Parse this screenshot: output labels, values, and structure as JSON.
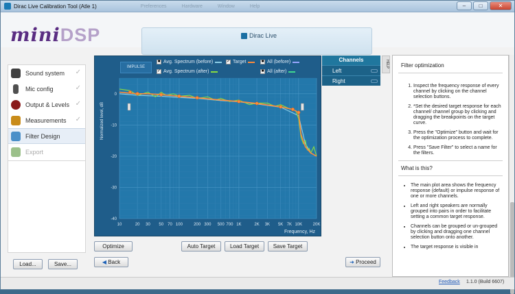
{
  "window": {
    "title": "Dirac Live Calibration Tool (Atle 1)",
    "menu": [
      "Preferences",
      "Hardware",
      "Window",
      "Help"
    ],
    "minimize": "–",
    "maximize": "□",
    "close": "✕"
  },
  "brand": {
    "logo_main": "mini",
    "logo_sub": "DSP",
    "product": "Dirac Live"
  },
  "sidebar": {
    "items": [
      {
        "label": "Sound system",
        "icon": "speaker-icon",
        "color": "#404040"
      },
      {
        "label": "Mic config",
        "icon": "microphone-icon",
        "color": "#505050"
      },
      {
        "label": "Output & Levels",
        "icon": "output-levels-icon",
        "color": "#8a1a1a"
      },
      {
        "label": "Measurements",
        "icon": "measurement-icon",
        "color": "#c98c1a"
      },
      {
        "label": "Filter Design",
        "icon": "filter-design-icon",
        "color": "#4a8fc8"
      },
      {
        "label": "Export",
        "icon": "export-icon",
        "color": "#9bc08a"
      }
    ],
    "check": "✓"
  },
  "buttons": {
    "load": "Load...",
    "save": "Save...",
    "optimize": "Optimize",
    "auto_target": "Auto Target",
    "load_target": "Load Target",
    "save_target": "Save Target",
    "back": "Back",
    "proceed": "Proceed"
  },
  "plot": {
    "impulse": "IMPULSE",
    "legend": [
      {
        "label": "Avg. Spectrum (before)",
        "checked": "■",
        "color": "#8fd0e8"
      },
      {
        "label": "Target",
        "checked": "✓",
        "color": "#ff8a3a"
      },
      {
        "label": "All (before)",
        "checked": "■",
        "color": "#9aa7ff"
      },
      {
        "label": "Avg. Spectrum (after)",
        "checked": "✓",
        "color": "#8bdc40"
      },
      {
        "label": "All (after)",
        "checked": "■",
        "color": "#40d890"
      }
    ]
  },
  "channels": {
    "header": "Channels",
    "items": [
      "Left",
      "Right"
    ]
  },
  "help": {
    "tab": "HELP",
    "title": "Filter optimization",
    "steps": [
      "Inspect the frequency response of every channel by clicking on the channel selection buttons.",
      "*Set the desired target response for each channel/ channel group by clicking and dragging the breakpoints on the target curve.",
      "Press the \"Optimize\" button and wait for the optimization process to complete.",
      "Press \"Save Filter\" to select a name for the filters."
    ],
    "what_title": "What is this?",
    "bullets": [
      "The main plot area shows the frequency response (default) or impulse response of one or more channels.",
      "Left and right speakers are normally grouped into pairs in order to facilitate setting a common target response.",
      "Channels can be grouped or un-grouped by clicking and dragging one channel selection button onto another.",
      "The target response is visible in"
    ]
  },
  "status": {
    "feedback": "Feedback",
    "version": "1.1.0 (Build 6607)"
  },
  "chart_data": {
    "type": "line",
    "xlabel": "Frequency, Hz",
    "ylabel": "Normalized level, dB",
    "xscale": "log",
    "xlim": [
      10,
      20000
    ],
    "ylim": [
      -40,
      5
    ],
    "x_ticks": [
      "10",
      "20",
      "30",
      "50",
      "70",
      "100",
      "200",
      "300",
      "500",
      "700",
      "1K",
      "2K",
      "3K",
      "5K",
      "7K",
      "10K",
      "20K"
    ],
    "y_ticks": [
      "0",
      "-10",
      "-20",
      "-30",
      "-40"
    ],
    "grid": true,
    "series": [
      {
        "name": "Target",
        "color": "#ff8a3a",
        "x": [
          10,
          20,
          30,
          50,
          100,
          200,
          500,
          1000,
          2000,
          5000,
          8000,
          10000,
          11000,
          13000,
          16000,
          20000
        ],
        "y": [
          0.5,
          0,
          0,
          -0.3,
          -0.8,
          -1.3,
          -2,
          -2.5,
          -3.1,
          -4.2,
          -5,
          -6,
          -13,
          -17,
          -19,
          -20
        ]
      },
      {
        "name": "Avg. Spectrum (after)",
        "color": "#8bdc40",
        "x": [
          10,
          15,
          20,
          30,
          40,
          50,
          60,
          80,
          100,
          150,
          200,
          300,
          400,
          500,
          700,
          1000,
          1500,
          2000,
          3000,
          4000,
          5000,
          7000,
          9000,
          10000,
          11000,
          12000,
          13000,
          14000,
          15000,
          16000,
          18000,
          20000
        ],
        "y": [
          1.5,
          1,
          -0.5,
          0.5,
          -1,
          0.5,
          -0.5,
          0,
          -0.8,
          -0.5,
          -1.5,
          -1,
          -2,
          -1.5,
          -2.5,
          -2,
          -3.5,
          -3,
          -3,
          -4,
          -3.5,
          -4.8,
          -5.5,
          -8,
          -14,
          -16,
          -15,
          -18,
          -17.5,
          -19,
          -17,
          -20
        ]
      },
      {
        "name": "Avg. Spectrum (before)",
        "color": "#8fd0e8",
        "x": [
          10,
          20,
          50,
          100,
          200,
          500,
          1000,
          2000,
          5000,
          10000,
          13000,
          16000,
          20000
        ],
        "y": [
          0,
          -0.5,
          -0.8,
          -1.2,
          -1.5,
          -2.2,
          -2.6,
          -3.3,
          -4.3,
          -7,
          -16,
          -19,
          -20
        ]
      }
    ],
    "breakpoints": {
      "x": [
        15,
        20,
        50,
        100,
        200,
        1000,
        2000,
        5000,
        8000,
        10000
      ],
      "y": [
        0.5,
        0,
        -0.3,
        -0.8,
        -1.3,
        -2.5,
        -3.1,
        -4.2,
        -5,
        -6
      ]
    }
  }
}
